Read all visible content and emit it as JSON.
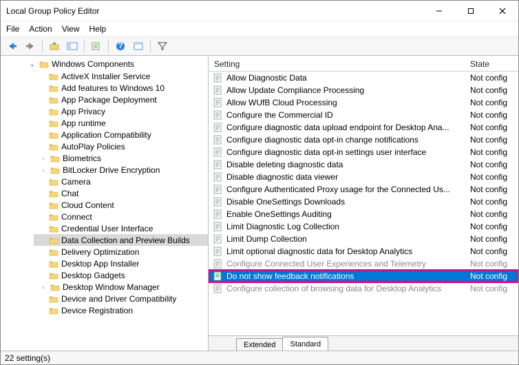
{
  "window": {
    "title": "Local Group Policy Editor"
  },
  "menu": [
    "File",
    "Action",
    "View",
    "Help"
  ],
  "tree": {
    "root": "Windows Components",
    "items": [
      {
        "label": "ActiveX Installer Service",
        "children": false
      },
      {
        "label": "Add features to Windows 10",
        "children": false
      },
      {
        "label": "App Package Deployment",
        "children": false
      },
      {
        "label": "App Privacy",
        "children": false
      },
      {
        "label": "App runtime",
        "children": false
      },
      {
        "label": "Application Compatibility",
        "children": false
      },
      {
        "label": "AutoPlay Policies",
        "children": false
      },
      {
        "label": "Biometrics",
        "children": true
      },
      {
        "label": "BitLocker Drive Encryption",
        "children": true
      },
      {
        "label": "Camera",
        "children": false
      },
      {
        "label": "Chat",
        "children": false
      },
      {
        "label": "Cloud Content",
        "children": false
      },
      {
        "label": "Connect",
        "children": false
      },
      {
        "label": "Credential User Interface",
        "children": false
      },
      {
        "label": "Data Collection and Preview Builds",
        "children": false,
        "selected": true
      },
      {
        "label": "Delivery Optimization",
        "children": false
      },
      {
        "label": "Desktop App Installer",
        "children": false
      },
      {
        "label": "Desktop Gadgets",
        "children": false
      },
      {
        "label": "Desktop Window Manager",
        "children": true
      },
      {
        "label": "Device and Driver Compatibility",
        "children": false
      },
      {
        "label": "Device Registration",
        "children": false
      }
    ]
  },
  "list": {
    "columns": {
      "setting": "Setting",
      "state": "State"
    },
    "rows": [
      {
        "label": "Allow Diagnostic Data",
        "state": "Not config"
      },
      {
        "label": "Allow Update Compliance Processing",
        "state": "Not config"
      },
      {
        "label": "Allow WUfB Cloud Processing",
        "state": "Not config"
      },
      {
        "label": "Configure the Commercial ID",
        "state": "Not config"
      },
      {
        "label": "Configure diagnostic data upload endpoint for Desktop Ana...",
        "state": "Not config"
      },
      {
        "label": "Configure diagnostic data opt-in change notifications",
        "state": "Not config"
      },
      {
        "label": "Configure diagnostic data opt-in settings user interface",
        "state": "Not config"
      },
      {
        "label": "Disable deleting diagnostic data",
        "state": "Not config"
      },
      {
        "label": "Disable diagnostic data viewer",
        "state": "Not config"
      },
      {
        "label": "Configure Authenticated Proxy usage for the Connected Us...",
        "state": "Not config"
      },
      {
        "label": "Disable OneSettings Downloads",
        "state": "Not config"
      },
      {
        "label": "Enable OneSettings Auditing",
        "state": "Not config"
      },
      {
        "label": "Limit Diagnostic Log Collection",
        "state": "Not config"
      },
      {
        "label": "Limit Dump Collection",
        "state": "Not config"
      },
      {
        "label": "Limit optional diagnostic data for Desktop Analytics",
        "state": "Not config"
      },
      {
        "label": "Configure Connected User Experiences and Telemetry",
        "state": "Not config",
        "dimmed": true
      },
      {
        "label": "Do not show feedback notifications",
        "state": "Not config",
        "selected": true,
        "highlighted": true
      },
      {
        "label": "Configure collection of browsing data for Desktop Analytics",
        "state": "Not config",
        "dimmed": true
      }
    ]
  },
  "tabs": {
    "extended": "Extended",
    "standard": "Standard"
  },
  "status": "22 setting(s)"
}
